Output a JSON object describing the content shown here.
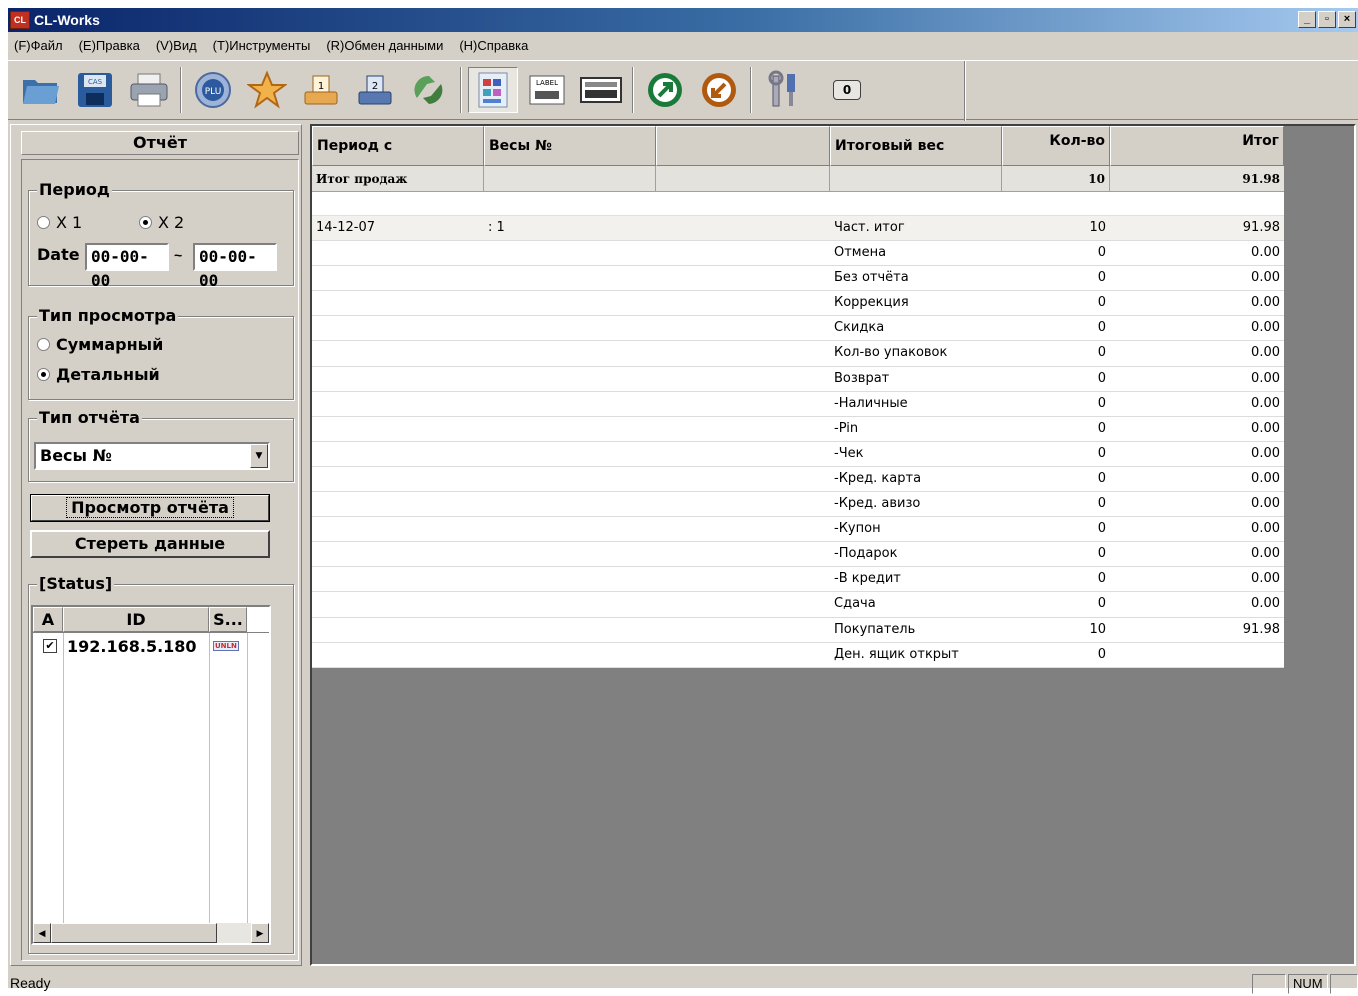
{
  "window": {
    "title": "CL-Works",
    "icon_text": "CL",
    "minimize": "_",
    "restore": "▫",
    "close": "×"
  },
  "menu": [
    "(F)Файл",
    "(E)Правка",
    "(V)Вид",
    "(T)Инструменты",
    "(R)Обмен данными",
    "(H)Справка"
  ],
  "toolbar": {
    "counter_label": "0",
    "buttons": [
      "open-folder-icon",
      "save-scale-icon",
      "print-icon",
      "plu-icon",
      "star-icon",
      "scale-1-icon",
      "scale-2-icon",
      "recycle-icon",
      "report-icon",
      "label-icon",
      "keyboard-icon",
      "send-icon",
      "receive-icon",
      "tools-icon"
    ],
    "plu_text": "PLU",
    "label_text": "LABEL",
    "cas_text": "CAS"
  },
  "left": {
    "title": "Отчёт",
    "period": {
      "legend": "Период",
      "x1": "X 1",
      "x2": "X 2",
      "selected": "x2",
      "date_label": "Date",
      "date_from": "00-00-00",
      "sep": "~",
      "date_to": "00-00-00"
    },
    "view_type": {
      "legend": "Тип просмотра",
      "summary": "Суммарный",
      "detailed": "Детальный",
      "selected": "detailed"
    },
    "report_type": {
      "legend": "Тип отчёта",
      "value": "Весы №"
    },
    "view_button": "Просмотр отчёта",
    "clear_button": "Стереть данные",
    "status": {
      "legend": "[Status]",
      "columns": [
        "A",
        "ID",
        "S..."
      ],
      "rows": [
        {
          "checked": true,
          "id": "192.168.5.180",
          "s": "UNLN"
        }
      ]
    }
  },
  "grid": {
    "columns": [
      "Период с",
      "Весы №",
      "",
      "Итоговый вес",
      "Кол-во",
      "Итог"
    ],
    "total_row": {
      "label": "Итог продаж",
      "qty": "10",
      "total": "91.98"
    },
    "first_row": {
      "period": "14-12-07",
      "scale": ": 1"
    },
    "rows": [
      {
        "name": "Част. итог",
        "qty": "10",
        "total": "91.98"
      },
      {
        "name": "Отмена",
        "qty": "0",
        "total": "0.00"
      },
      {
        "name": "Без отчёта",
        "qty": "0",
        "total": "0.00"
      },
      {
        "name": "Коррекция",
        "qty": "0",
        "total": "0.00"
      },
      {
        "name": "Скидка",
        "qty": "0",
        "total": "0.00"
      },
      {
        "name": "Кол-во упаковок",
        "qty": "0",
        "total": "0.00"
      },
      {
        "name": "Возврат",
        "qty": "0",
        "total": "0.00"
      },
      {
        "name": "-Наличные",
        "qty": "0",
        "total": "0.00"
      },
      {
        "name": "-Pin",
        "qty": "0",
        "total": "0.00"
      },
      {
        "name": "-Чек",
        "qty": "0",
        "total": "0.00"
      },
      {
        "name": "-Кред. карта",
        "qty": "0",
        "total": "0.00"
      },
      {
        "name": "-Кред. авизо",
        "qty": "0",
        "total": "0.00"
      },
      {
        "name": "-Купон",
        "qty": "0",
        "total": "0.00"
      },
      {
        "name": "-Подарок",
        "qty": "0",
        "total": "0.00"
      },
      {
        "name": "-В кредит",
        "qty": "0",
        "total": "0.00"
      },
      {
        "name": "Сдача",
        "qty": "0",
        "total": "0.00"
      },
      {
        "name": "Покупатель",
        "qty": "10",
        "total": "91.98"
      },
      {
        "name": "Ден. ящик открыт",
        "qty": "0",
        "total": ""
      }
    ]
  },
  "statusbar": {
    "text": "Ready",
    "num": "NUM"
  }
}
